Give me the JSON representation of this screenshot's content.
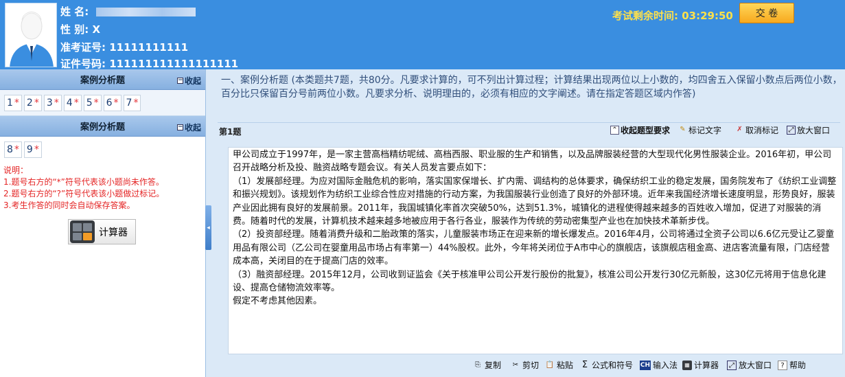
{
  "candidate": {
    "name_label": "姓 名:",
    "gender_label": "性 别:",
    "gender_value": "X",
    "admission_label": "准考证号:",
    "admission_value": "11111111111",
    "id_label": "证件号码:",
    "id_value": "111111111111111111"
  },
  "exam": {
    "timer_label": "考试剩余时间:",
    "timer_value": "03:29:50",
    "submit_label": "交 卷"
  },
  "left_panel": {
    "sections": [
      {
        "title": "案例分析题",
        "collapse_label": "收起",
        "questions": [
          {
            "num": "1",
            "mark": "*"
          },
          {
            "num": "2",
            "mark": "*"
          },
          {
            "num": "3",
            "mark": "*"
          },
          {
            "num": "4",
            "mark": "*"
          },
          {
            "num": "5",
            "mark": "*"
          },
          {
            "num": "6",
            "mark": "*"
          },
          {
            "num": "7",
            "mark": "*"
          }
        ]
      },
      {
        "title": "案例分析题",
        "collapse_label": "收起",
        "questions": [
          {
            "num": "8",
            "mark": "*"
          },
          {
            "num": "9",
            "mark": "*"
          }
        ]
      }
    ],
    "notes": [
      "说明：",
      "1.题号右方的“*”符号代表该小题尚未作答。",
      "2.题号右方的“?”符号代表该小题做过标记。",
      "3.考生作答的同时会自动保存答案。"
    ],
    "calculator_label": "计算器"
  },
  "instructions": "一、案例分析题 (本类题共7题，共80分。凡要求计算的，可不列出计算过程；计算结果出现两位以上小数的，均四舍五入保留小数点后两位小数，百分比只保留百分号前两位小数。凡要求分析、说明理由的，必须有相应的文字阐述。请在指定答题区域内作答)",
  "question_bar": {
    "title": "第1题",
    "collapse_req": "收起题型要求",
    "mark_text": "标记文字",
    "cancel_mark": "取消标记",
    "enlarge": "放大窗口"
  },
  "question_content": [
    "甲公司成立于1997年，是一家主营高档精纺呢绒、高档西服、职业服的生产和销售，以及品牌服装经营的大型现代化男性服装企业。2016年初，甲公司召开战略分析及投、融资战略专题会议。有关人员发言要点如下：",
    "（1）发展部经理。为应对国际金融危机的影响，落实国家保增长、扩内需、调结构的总体要求，确保纺织工业的稳定发展，国务院发布了《纺织工业调整和振兴规划》。该规划作为纺织工业综合性应对措施的行动方案，为我国服装行业创造了良好的外部环境。近年来我国经济增长速度明显，形势良好，服装产业因此拥有良好的发展前景。2011年，我国城镇化率首次突破50%，达到51.3%，城镇化的进程使得越来越多的百姓收入增加，促进了对服装的消费。随着时代的发展，计算机技术越来越多地被应用于各行各业，服装作为传统的劳动密集型产业也在加快技术革新步伐。",
    "（2）投资部经理。随着消费升级和二胎政策的落实，儿童服装市场正在迎来新的增长爆发点。2016年4月，公司将通过全资子公司以6.6亿元受让乙婴童用品有限公司（乙公司在婴童用品市场占有率第一）44%股权。此外，今年将关闭位于A市中心的旗舰店，该旗舰店租金高、进店客流量有限，门店经营成本高，关闭目的在于提高门店的效率。",
    "（3）融资部经理。2015年12月，公司收到证监会《关于核准甲公司公开发行股份的批复》，核准公司公开发行30亿元新股，这30亿元将用于信息化建设、提高仓储物流效率等。",
    "假定不考虑其他因素。"
  ],
  "bottom_toolbar": {
    "copy": "复制",
    "cut": "剪切",
    "paste": "粘贴",
    "formula": "公式和符号",
    "input_method": "输入法",
    "calculator": "计算器",
    "enlarge": "放大窗口",
    "help": "帮助"
  },
  "colors": {
    "header_bg": "#3a8ee0",
    "timer": "#ffe14a",
    "submit_btn": "#f7a91e",
    "unanswered_mark": "#e4353a",
    "notes": "#e42424",
    "instructions": "#304e7a"
  }
}
